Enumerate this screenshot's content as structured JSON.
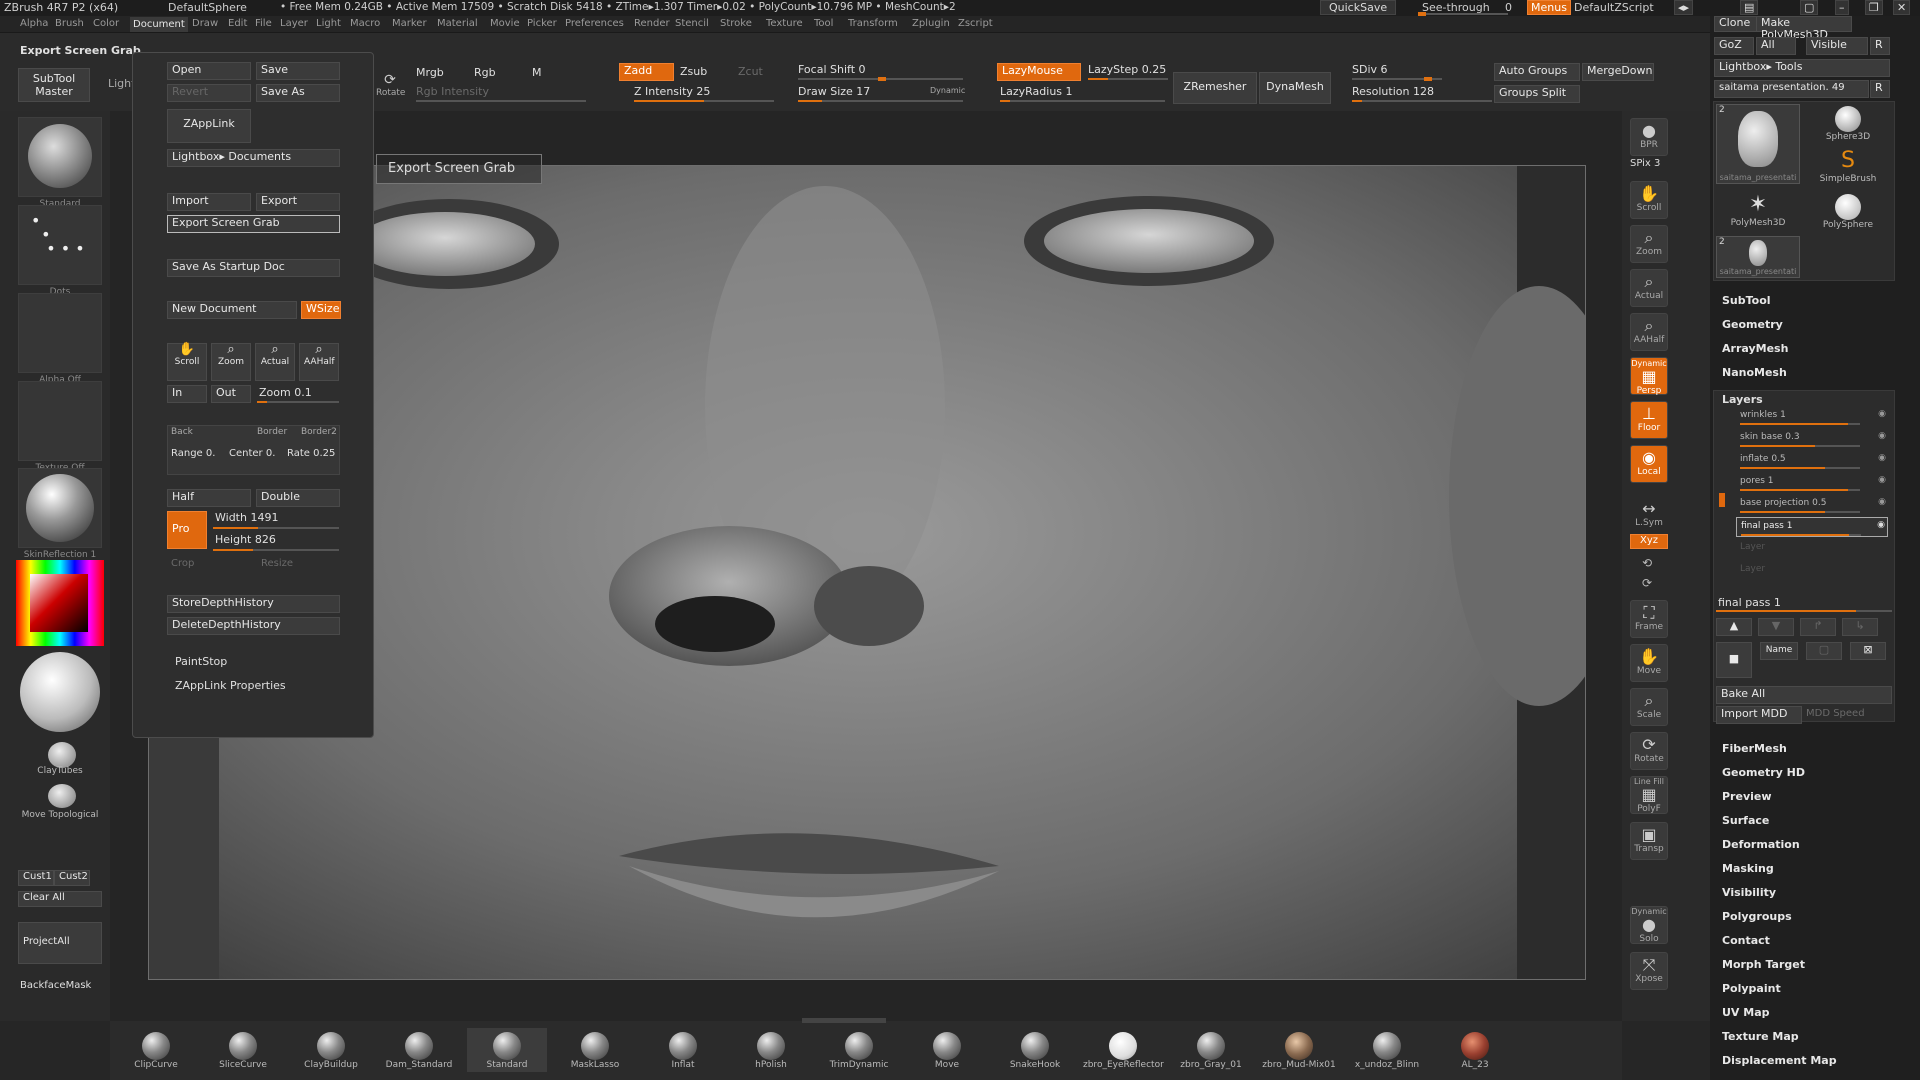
{
  "topbar": {
    "app_title": "ZBrush 4R7 P2 (x64)",
    "document": "DefaultSphere",
    "stats": "• Free Mem 0.24GB • Active Mem 17509 • Scratch Disk 5418 • ZTime▸1.307 Timer▸0.02 • PolyCount▸10.796 MP • MeshCount▸2",
    "quicksave": "QuickSave",
    "seethrough": "See-through",
    "seethrough_value": "0",
    "menus": "Menus",
    "script": "DefaultZScript"
  },
  "menubar": [
    "Alpha",
    "Brush",
    "Color",
    "Document",
    "Draw",
    "Edit",
    "File",
    "Layer",
    "Light",
    "Macro",
    "Marker",
    "Material",
    "Movie",
    "Picker",
    "Preferences",
    "Render",
    "Stencil",
    "Stroke",
    "Texture",
    "Tool",
    "Transform",
    "Zplugin",
    "Zscript"
  ],
  "menubar_active": "Document",
  "doc_title": "Export Screen Grab",
  "docmenu": {
    "open": "Open",
    "save": "Save",
    "revert": "Revert",
    "save_as": "Save As",
    "zapplink": "ZAppLink",
    "lightbox_docs": "Lightbox▸ Documents",
    "import": "Import",
    "export": "Export",
    "export_grab": "Export Screen Grab",
    "save_startup": "Save As Startup Doc",
    "new_doc": "New Document",
    "wsize": "WSize",
    "scroll": "Scroll",
    "zoom": "Zoom",
    "actual": "Actual",
    "aahalf": "AAHalf",
    "in": "In",
    "out": "Out",
    "zoom_slider": "Zoom 0.1",
    "back": "Back",
    "border": "Border",
    "border2": "Border2",
    "range": "Range 0.",
    "center": "Center 0.",
    "rate": "Rate 0.25",
    "half": "Half",
    "double": "Double",
    "pro": "Pro",
    "width": "Width 1491",
    "height": "Height 826",
    "crop": "Crop",
    "resize": "Resize",
    "store_depth": "StoreDepthHistory",
    "delete_depth": "DeleteDepthHistory",
    "paintstop": "PaintStop",
    "zapplink_props": "ZAppLink Properties"
  },
  "tooltip": "Export Screen Grab",
  "topshelf": {
    "mrgb": "Mrgb",
    "rgb": "Rgb",
    "m": "M",
    "rgb_intensity": "Rgb Intensity",
    "zadd": "Zadd",
    "zsub": "Zsub",
    "zcut": "Zcut",
    "z_intensity": "Z Intensity 25",
    "focal_shift": "Focal Shift 0",
    "draw_size": "Draw Size 17",
    "dynamic": "Dynamic",
    "lazymouse": "LazyMouse",
    "lazystep": "LazyStep 0.25",
    "lazyradius": "LazyRadius 1",
    "zremesher": "ZRemesher",
    "dynamesh": "DynaMesh",
    "sdiv": "SDiv 6",
    "resolution": "Resolution 128",
    "auto_groups": "Auto Groups",
    "mergedown": "MergeDown",
    "groups_split": "Groups Split",
    "rotate": "Rotate"
  },
  "left": {
    "subtool_master": "SubTool Master",
    "lightbox": "LightBox",
    "brush": "Standard",
    "stroke": "Dots",
    "alpha": "Alpha Off",
    "texture": "Texture Off",
    "material": "SkinReflection 1",
    "cliptubes": "ClayTubes",
    "move_topo": "Move Topological",
    "cust1": "Cust1",
    "cust2": "Cust2",
    "clear_all": "Clear All",
    "projectall": "ProjectAll",
    "backfacemask": "BackfaceMask"
  },
  "right": {
    "bpr": "BPR",
    "spix": "SPix 3",
    "scroll": "Scroll",
    "zoom": "Zoom",
    "actual": "Actual",
    "aahalf": "AAHalf",
    "persp": "Persp",
    "dynamic": "Dynamic",
    "floor": "Floor",
    "local": "Local",
    "lsym": "L.Sym",
    "xyz": "Xyz",
    "frame": "Frame",
    "move": "Move",
    "scale": "Scale",
    "rotate": "Rotate",
    "linefill": "Line Fill",
    "polyf": "PolyF",
    "transp": "Transp",
    "solo": "Solo",
    "dynamic2": "Dynamic",
    "xpose": "Xpose"
  },
  "tray": {
    "clone": "Clone",
    "make_polymesh": "Make PolyMesh3D",
    "goz": "GoZ",
    "all": "All",
    "visible": "Visible",
    "r": "R",
    "lightbox_tools": "Lightbox▸ Tools",
    "tool_name": "saitama presentation. 49",
    "tool_r": "R",
    "tools": [
      "saitama_presentati",
      "Sphere3D",
      "SimpleBrush",
      "PolyMesh3D",
      "PolySphere",
      "saitama_presentati"
    ],
    "tool_counts": [
      "2",
      "2"
    ],
    "sections_top": [
      "SubTool",
      "Geometry",
      "ArrayMesh",
      "NanoMesh"
    ],
    "layers_title": "Layers",
    "layers": [
      "wrinkles 1",
      "skin base 0.3",
      "inflate 0.5",
      "pores 1",
      "base projection 0.5",
      "final pass 1",
      "Layer",
      "Layer"
    ],
    "layer_sel": "final pass 1",
    "name_btn": "Name",
    "bake_all": "Bake All",
    "import_mdd": "Import MDD",
    "mdd_speed": "MDD Speed",
    "sections_bottom": [
      "FiberMesh",
      "Geometry HD",
      "Preview",
      "Surface",
      "Deformation",
      "Masking",
      "Visibility",
      "Polygroups",
      "Contact",
      "Morph Target",
      "Polypaint",
      "UV Map",
      "Texture Map",
      "Displacement Map"
    ]
  },
  "bottom_brushes": [
    "ClipCurve",
    "SliceCurve",
    "ClayBuildup",
    "Dam_Standard",
    "Standard",
    "MaskLasso",
    "Inflat",
    "hPolish",
    "TrimDynamic",
    "Move",
    "SnakeHook",
    "zbro_EyeReflector",
    "zbro_Gray_01",
    "zbro_Mud-Mix01",
    "x_undoz_Blinn",
    "AL_23"
  ],
  "colors": {
    "accent": "#e0680e",
    "panel": "#2c2c2c",
    "viewport": "#7a7a7a"
  }
}
